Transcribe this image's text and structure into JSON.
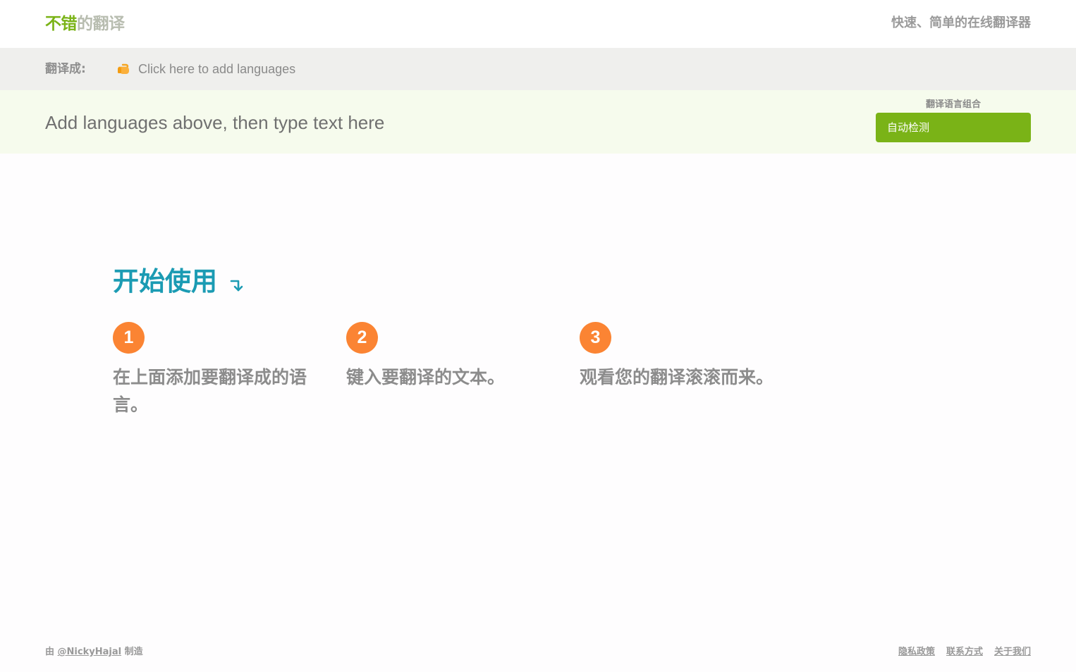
{
  "header": {
    "logo_part1": "不错",
    "logo_part2": "的翻译",
    "tagline": "快速、简单的在线翻译器"
  },
  "language_bar": {
    "label": "翻译成:",
    "add_languages": "Click here to add languages",
    "icon": "pointing-hand-icon"
  },
  "input": {
    "placeholder": "Add languages above, then type text here",
    "value": ""
  },
  "language_combo": {
    "label": "翻译语言组合",
    "selected": "自动检测"
  },
  "getting_started": {
    "title": "开始使用",
    "icon": "down-right-arrow-icon",
    "steps": [
      {
        "number": "1",
        "text": "在上面添加要翻译成的语言。"
      },
      {
        "number": "2",
        "text": "键入要翻译的文本。"
      },
      {
        "number": "3",
        "text": "观看您的翻译滚滚而来。"
      }
    ]
  },
  "footer": {
    "made_by_prefix": "由",
    "author": "@NickyHajal",
    "made_by_suffix": "制造",
    "links": [
      "隐私政策",
      "联系方式",
      "关于我们"
    ]
  },
  "colors": {
    "brand_green": "#7ab317",
    "title_teal": "#1b9bb3",
    "step_orange": "#fb8433"
  }
}
